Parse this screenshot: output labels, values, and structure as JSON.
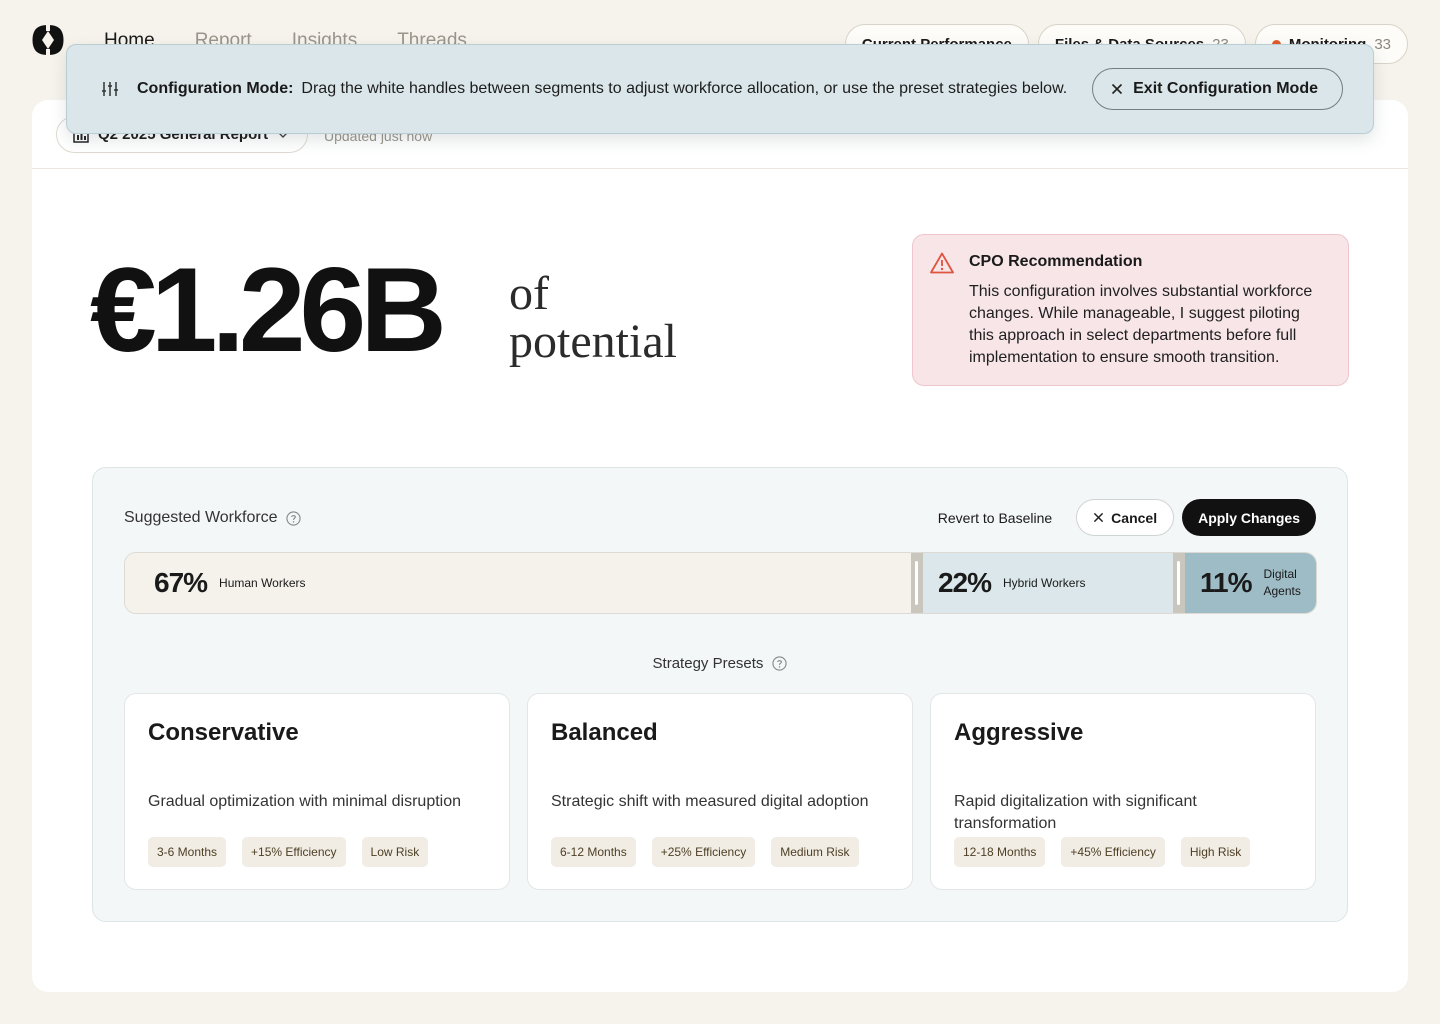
{
  "nav": {
    "tabs": [
      "Home",
      "Report",
      "Insights",
      "Threads"
    ],
    "pills": {
      "performance": "Current Performance",
      "files": "Files & Data Sources",
      "files_count": "23",
      "monitoring": "Monitoring",
      "monitoring_count": "33"
    }
  },
  "report": {
    "selected": "Q2 2025 General Report",
    "updated": "Updated just now"
  },
  "banner": {
    "title": "Configuration Mode:",
    "text": "Drag the white handles between segments to adjust workforce allocation, or use the preset strategies below.",
    "exit_label": "Exit Configuration Mode"
  },
  "potential": {
    "value": "€1.26B",
    "suffix_1": "of",
    "suffix_2": "potential"
  },
  "cpo": {
    "title": "CPO Recommendation",
    "text": "This configuration involves substantial workforce changes. While manageable, I suggest piloting this approach in select departments before full implementation to ensure smooth transition."
  },
  "workforce": {
    "title": "Suggested Workforce",
    "revert_label": "Revert to Baseline",
    "cancel_label": "Cancel",
    "apply_label": "Apply Changes",
    "segments": [
      {
        "pct": "67%",
        "label": "Human Workers",
        "share": 0.67
      },
      {
        "pct": "22%",
        "label": "Hybrid Workers",
        "share": 0.22
      },
      {
        "pct": "11%",
        "label_1": "Digital",
        "label_2": "Agents",
        "share": 0.11
      }
    ],
    "presets_title": "Strategy Presets",
    "presets": [
      {
        "name": "Conservative",
        "desc": "Gradual optimization with minimal disruption",
        "tags": [
          "3-6 Months",
          "+15% Efficiency",
          "Low Risk"
        ]
      },
      {
        "name": "Balanced",
        "desc": "Strategic shift with measured digital adoption",
        "tags": [
          "6-12 Months",
          "+25% Efficiency",
          "Medium Risk"
        ]
      },
      {
        "name": "Aggressive",
        "desc": "Rapid digitalization with significant transformation",
        "tags": [
          "12-18 Months",
          "+45% Efficiency",
          "High Risk"
        ]
      }
    ]
  },
  "colors": {
    "background": "#f6f3ec",
    "banner": "#dae6ea",
    "cpo_bg": "#f7e5e8",
    "warning": "#e0533d",
    "human_segment": "#f5f2eb",
    "hybrid_segment": "#dbe7ea",
    "digital_segment": "#9ebcc6",
    "monitoring_dot": "#e25a2a"
  }
}
